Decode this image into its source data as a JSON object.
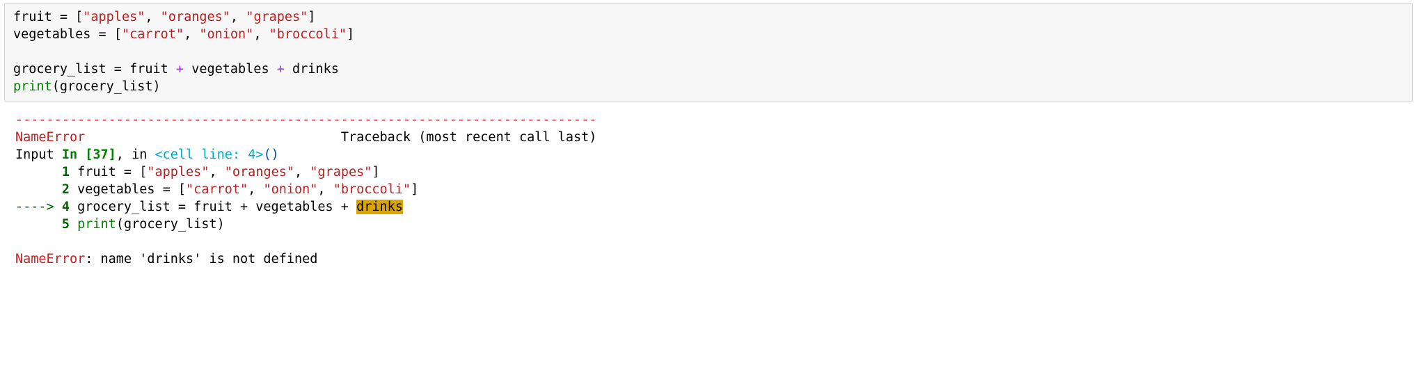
{
  "source": {
    "line1": {
      "var": "fruit",
      "assign": " = ",
      "br1": "[",
      "s1": "\"apples\"",
      "c1": ", ",
      "s2": "\"oranges\"",
      "c2": ", ",
      "s3": "\"grapes\"",
      "br2": "]"
    },
    "line2": {
      "var": "vegetables",
      "assign": " = ",
      "br1": "[",
      "s1": "\"carrot\"",
      "c1": ", ",
      "s2": "\"onion\"",
      "c2": ", ",
      "s3": "\"broccoli\"",
      "br2": "]"
    },
    "line4": {
      "var1": "grocery_list",
      "assign": " = ",
      "var2": "fruit",
      "sp1": " ",
      "op1": "+",
      "sp2": " ",
      "var3": "vegetables",
      "sp3": " ",
      "op2": "+",
      "sp4": " ",
      "var4": "drinks"
    },
    "line5": {
      "fn": "print",
      "p1": "(",
      "arg": "grocery_list",
      "p2": ")"
    }
  },
  "traceback": {
    "dashes": "---------------------------------------------------------------------------",
    "err_header_name": "NameError",
    "err_header_spacer": "                                 ",
    "err_header_tb": "Traceback (most recent call last)",
    "input_word": "Input ",
    "in_label": "In [37]",
    "comma_in": ", in ",
    "cell_line": "<cell line: 4>",
    "paren_open": "(",
    "paren_close": ")",
    "tb_line1": {
      "indent": "      ",
      "no": "1",
      "sp": " ",
      "code_pre": "fruit = [",
      "s1": "\"apples\"",
      "c1": ", ",
      "s2": "\"oranges\"",
      "c2": ", ",
      "s3": "\"grapes\"",
      "post": "]"
    },
    "tb_line2": {
      "indent": "      ",
      "no": "2",
      "sp": " ",
      "code_pre": "vegetables = [",
      "s1": "\"carrot\"",
      "c1": ", ",
      "s2": "\"onion\"",
      "c2": ", ",
      "s3": "\"broccoli\"",
      "post": "]"
    },
    "tb_line4": {
      "arrow": "----> ",
      "no": "4",
      "sp": " ",
      "pre": "grocery_list = fruit + vegetables + ",
      "hl": "drinks"
    },
    "tb_line5": {
      "indent": "      ",
      "no": "5",
      "sp": " ",
      "fn": "print",
      "rest": "(grocery_list)"
    },
    "final_name": "NameError",
    "final_msg": ": name 'drinks' is not defined"
  }
}
